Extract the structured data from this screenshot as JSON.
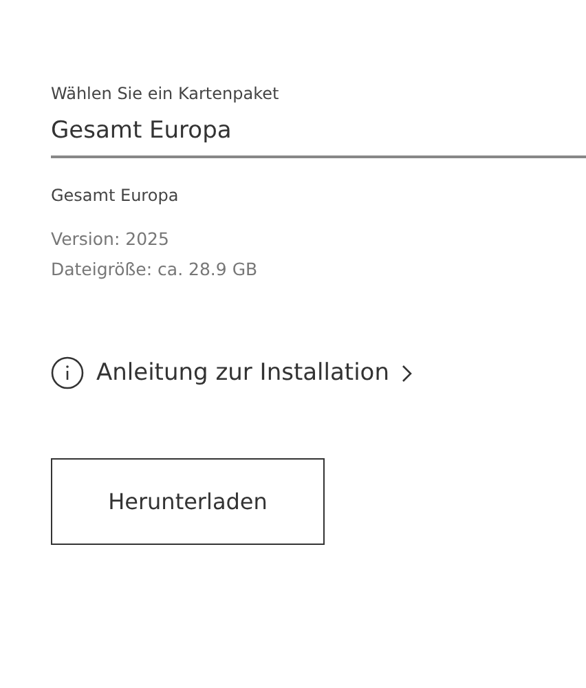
{
  "package_select": {
    "label": "Wählen Sie ein Kartenpaket",
    "value": "Gesamt Europa"
  },
  "package_info": {
    "name": "Gesamt Europa",
    "version": "Version: 2025",
    "size": "Dateigröße: ca. 28.9 GB"
  },
  "install_link": {
    "label": "Anleitung zur Installation"
  },
  "download_button": {
    "label": "Herunterladen"
  }
}
